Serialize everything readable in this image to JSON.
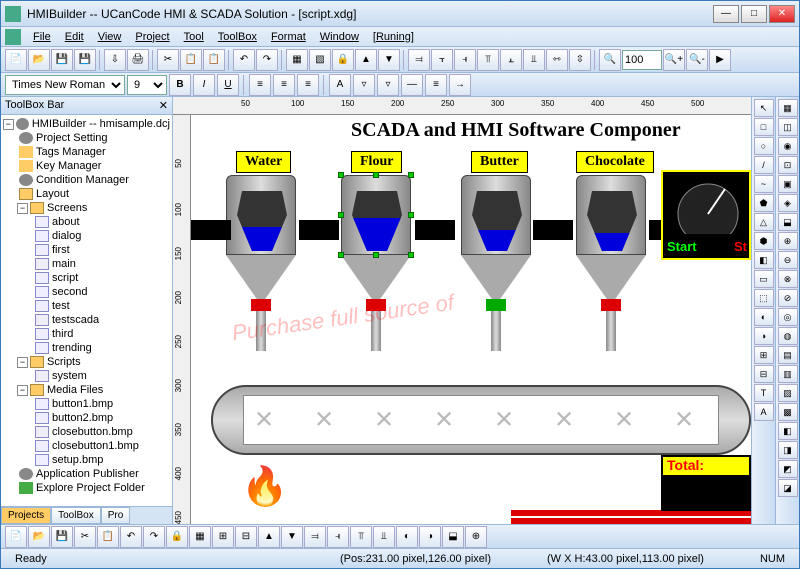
{
  "window": {
    "title": "HMIBuilder -- UCanCode HMI & SCADA Solution - [script.xdg]"
  },
  "menu": {
    "items": [
      "File",
      "Edit",
      "View",
      "Project",
      "Tool",
      "ToolBox",
      "Format",
      "Window",
      "Runing"
    ]
  },
  "toolbar2": {
    "font": "Times New Roman",
    "size": "9",
    "zoom": "100"
  },
  "sidebar": {
    "title": "ToolBox Bar",
    "root": "HMIBuilder -- hmisample.dcj",
    "project_setting": "Project Setting",
    "tags_manager": "Tags Manager",
    "key_manager": "Key Manager",
    "condition_manager": "Condition Manager",
    "layout": "Layout",
    "screens": "Screens",
    "screen_items": [
      "about",
      "dialog",
      "first",
      "main",
      "script",
      "second",
      "test",
      "testscada",
      "third",
      "trending"
    ],
    "scripts": "Scripts",
    "script_items": [
      "system"
    ],
    "media": "Media Files",
    "media_items": [
      "button1.bmp",
      "button2.bmp",
      "closebutton.bmp",
      "closebutton1.bmp",
      "setup.bmp"
    ],
    "app_publisher": "Application Publisher",
    "explore_folder": "Explore Project Folder",
    "tabs": [
      "Projects",
      "ToolBox",
      "Pro"
    ]
  },
  "canvas": {
    "title": "SCADA and HMI Software Componer",
    "labels": {
      "water": "Water",
      "flour": "Flour",
      "butter": "Butter",
      "chocolate": "Chocolate"
    },
    "gauge": {
      "start": "Start",
      "stop": "St"
    },
    "total": "Total:",
    "watermark": "Purchase full source of"
  },
  "ruler": {
    "h": [
      "50",
      "100",
      "150",
      "200",
      "250",
      "300",
      "350",
      "400",
      "450",
      "500"
    ],
    "v": [
      "50",
      "100",
      "150",
      "200",
      "250",
      "300",
      "350",
      "400",
      "450"
    ]
  },
  "status": {
    "ready": "Ready",
    "pos": "(Pos:231.00 pixel,126.00 pixel)",
    "size": "(W X H:43.00 pixel,113.00 pixel)",
    "num": "NUM"
  }
}
